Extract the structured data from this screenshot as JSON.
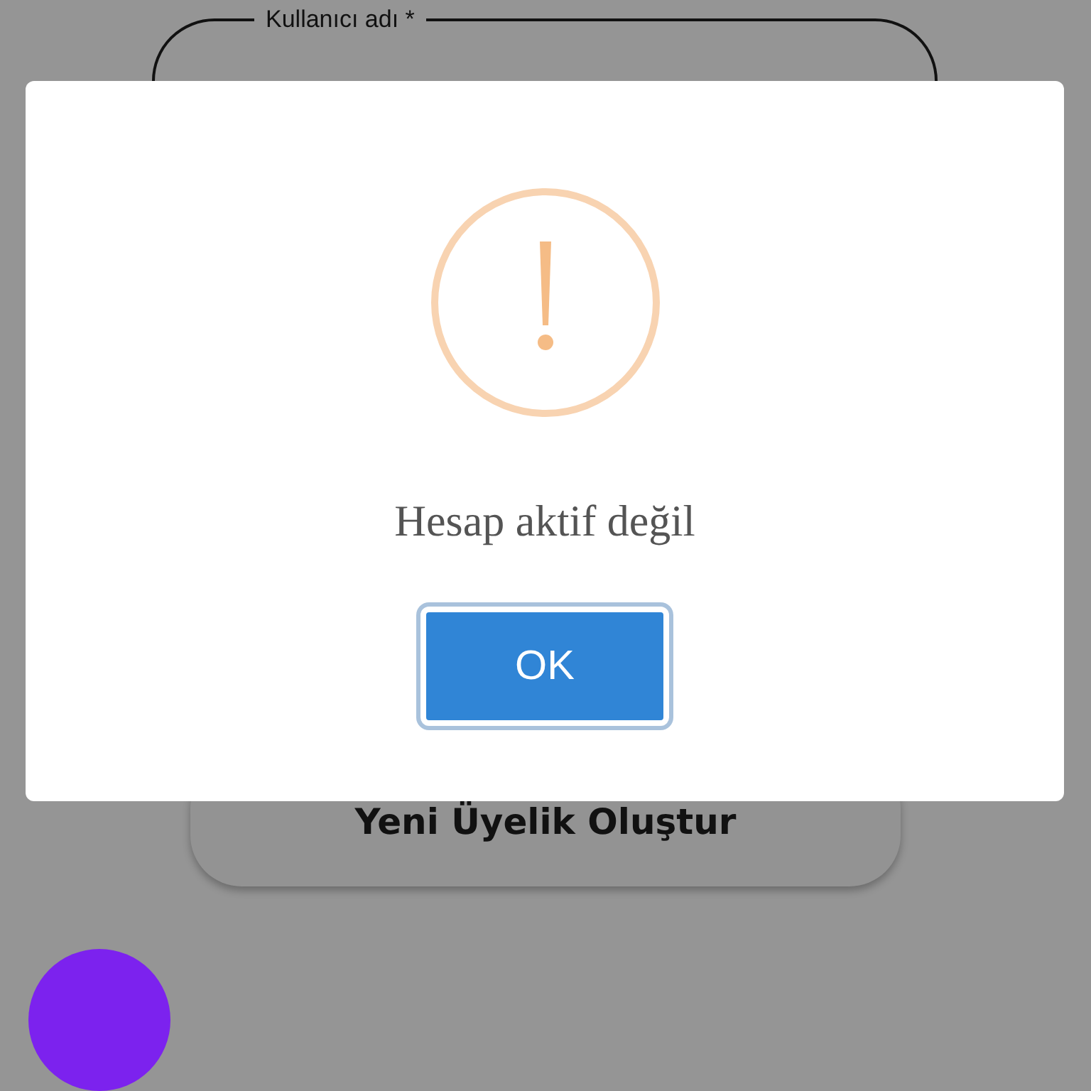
{
  "login_form": {
    "username_field": {
      "label": "Kullanıcı adı *"
    },
    "create_account_button": {
      "label": "Yeni Üyelik Oluştur"
    }
  },
  "alert": {
    "message": "Hesap aktif değil",
    "confirm_button": {
      "label": "OK"
    }
  }
}
